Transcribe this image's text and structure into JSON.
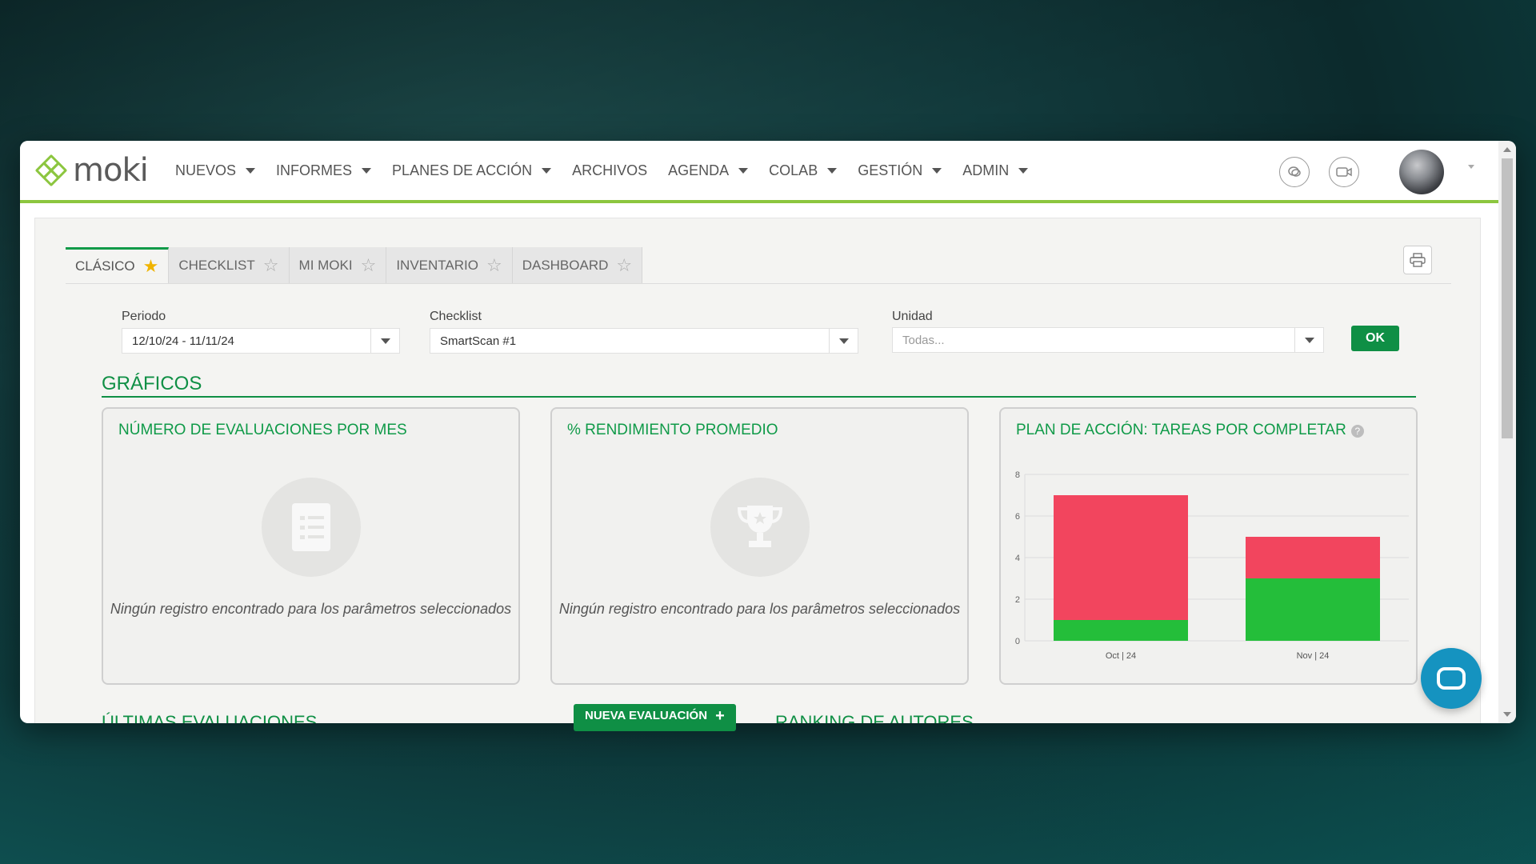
{
  "brand": {
    "name": "moki"
  },
  "nav": {
    "items": [
      {
        "label": "NUEVOS",
        "dropdown": true
      },
      {
        "label": "INFORMES",
        "dropdown": true
      },
      {
        "label": "PLANES DE ACCIÓN",
        "dropdown": true
      },
      {
        "label": "ARCHIVOS",
        "dropdown": false
      },
      {
        "label": "AGENDA",
        "dropdown": true
      },
      {
        "label": "COLAB",
        "dropdown": true
      },
      {
        "label": "GESTIÓN",
        "dropdown": true
      },
      {
        "label": "ADMIN",
        "dropdown": true
      }
    ],
    "icons": [
      "chat-icon",
      "video-icon"
    ]
  },
  "tabs": [
    {
      "label": "CLÁSICO",
      "favorite": true,
      "active": true
    },
    {
      "label": "CHECKLIST",
      "favorite": false,
      "active": false
    },
    {
      "label": "MI MOKI",
      "favorite": false,
      "active": false
    },
    {
      "label": "INVENTARIO",
      "favorite": false,
      "active": false
    },
    {
      "label": "DASHBOARD",
      "favorite": false,
      "active": false
    }
  ],
  "filters": {
    "periodo": {
      "label": "Periodo",
      "value": "12/10/24 - 11/11/24"
    },
    "checklist": {
      "label": "Checklist",
      "value": "SmartScan #1"
    },
    "unidad": {
      "label": "Unidad",
      "placeholder": "Todas..."
    },
    "ok_label": "OK"
  },
  "section": {
    "title": "GRÁFICOS"
  },
  "cards": {
    "evaluaciones": {
      "title": "NÚMERO DE EVALUACIONES POR MES",
      "empty_text": "Ningún registro encontrado para los parâmetros seleccionados"
    },
    "rendimiento": {
      "title": "% RENDIMIENTO PROMEDIO",
      "empty_text": "Ningún registro encontrado para los parâmetros seleccionados"
    },
    "plan": {
      "title": "PLAN DE ACCIÓN: TAREAS POR COMPLETAR",
      "help": "?"
    }
  },
  "chart_data": {
    "type": "bar",
    "stacked": true,
    "categories": [
      "Oct | 24",
      "Nov | 24"
    ],
    "series": [
      {
        "color": "#24be3a",
        "values": [
          1,
          3
        ]
      },
      {
        "color": "#f2455e",
        "values": [
          6,
          2
        ]
      }
    ],
    "ylim": [
      0,
      8
    ],
    "yticks": [
      0,
      2,
      4,
      6,
      8
    ],
    "grid": true
  },
  "bottom": {
    "ultimas": "ÚLTIMAS EVALUACIONES",
    "nueva_evaluacion": "NUEVA EVALUACIÓN",
    "ranking": "RANKING DE AUTORES"
  }
}
